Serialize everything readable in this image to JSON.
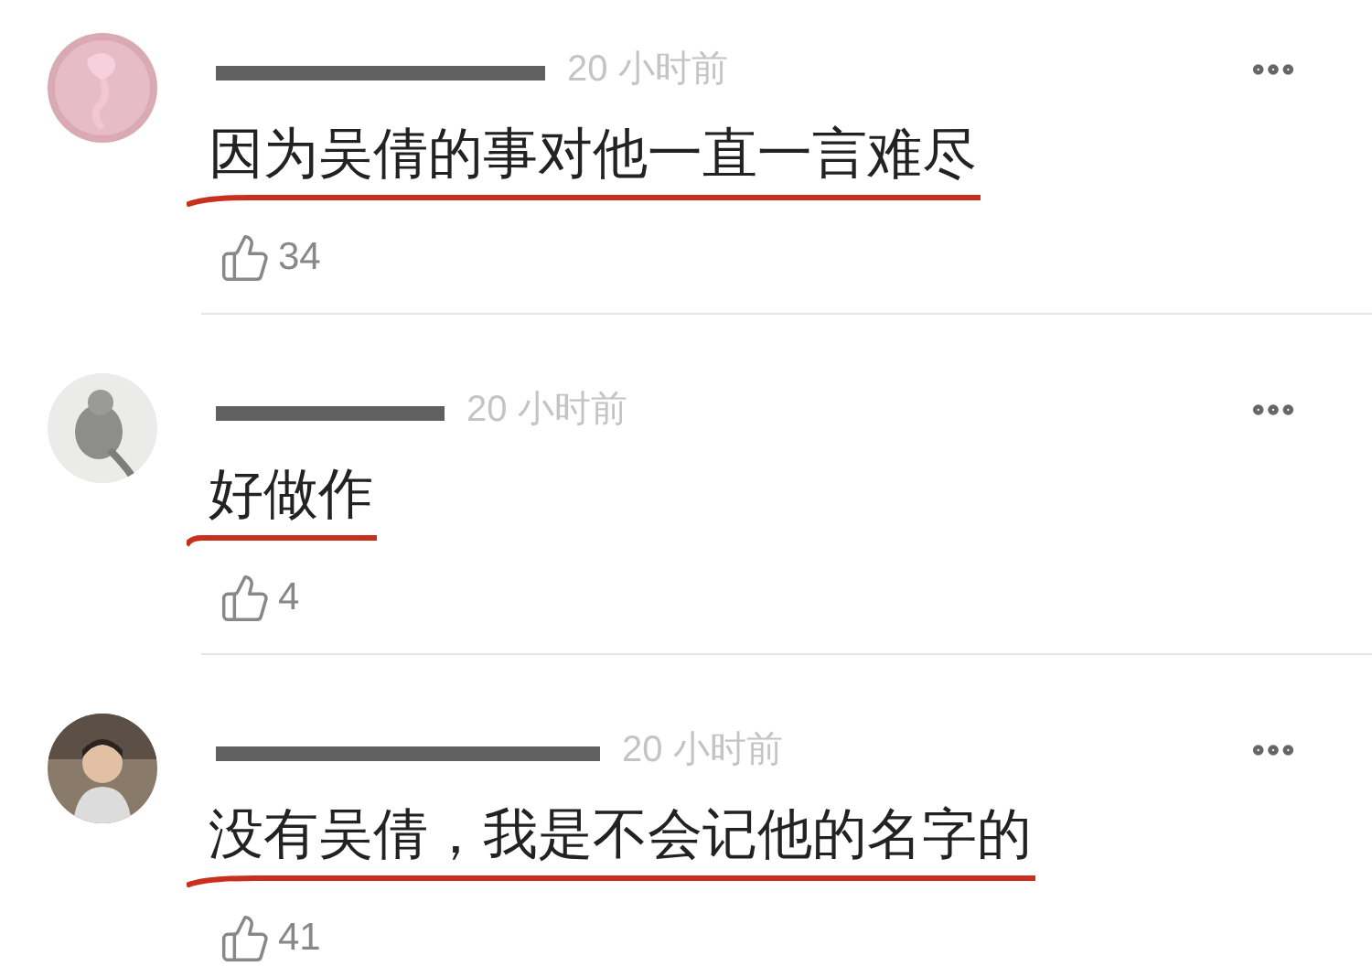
{
  "comments": [
    {
      "time": "20 小时前",
      "text": "因为吴倩的事对他一直一言难尽",
      "underlined": true,
      "likes": "34"
    },
    {
      "time": "20 小时前",
      "text": "好做作",
      "underlined": true,
      "likes": "4"
    },
    {
      "time": "20 小时前",
      "text": "没有吴倩，我是不会记他的名字的",
      "underlined": true,
      "likes": "41"
    }
  ]
}
